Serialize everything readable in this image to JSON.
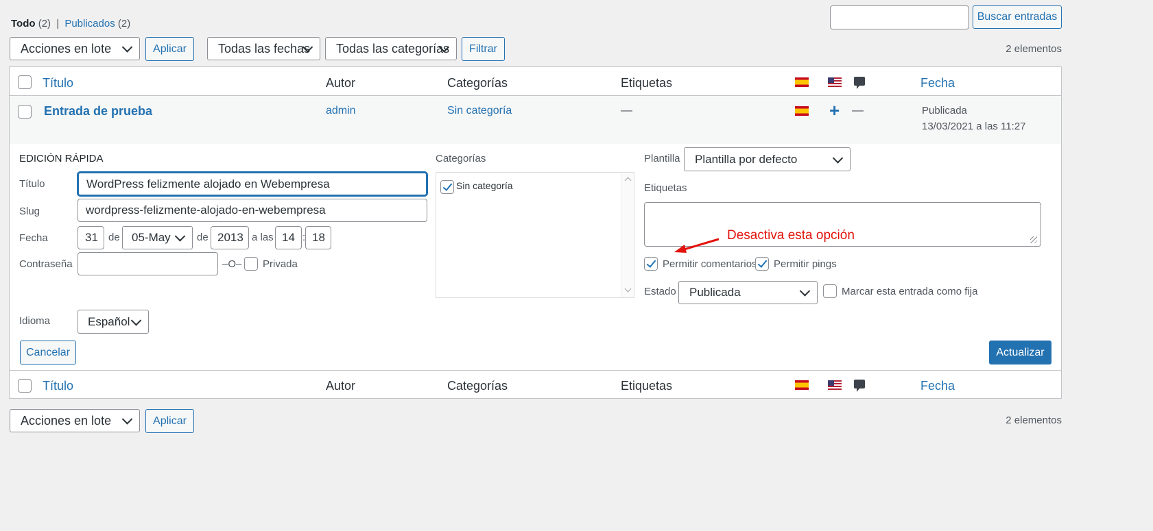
{
  "filters": {
    "all_label": "Todo",
    "all_count": "(2)",
    "separator": "|",
    "published_label": "Publicados",
    "published_count": "(2)"
  },
  "search": {
    "button_label": "Buscar entradas",
    "value": ""
  },
  "toolbar_top": {
    "bulk_select": "Acciones en lote",
    "apply_label": "Aplicar",
    "dates_select": "Todas las fechas",
    "categories_select": "Todas las categorías",
    "filter_label": "Filtrar",
    "item_count": "2 elementos"
  },
  "table": {
    "columns": {
      "title": "Título",
      "author": "Autor",
      "categories": "Categorías",
      "tags": "Etiquetas",
      "date": "Fecha"
    },
    "row": {
      "title": "Entrada de prueba",
      "author": "admin",
      "category": "Sin categoría",
      "tags": "—",
      "translation_add": "+",
      "comments": "—",
      "status": "Publicada",
      "datetime": "13/03/2021 a las 11:27"
    }
  },
  "quick_edit": {
    "heading": "EDICIÓN RÁPIDA",
    "title_label": "Título",
    "title_value": "WordPress felizmente alojado en Webempresa",
    "slug_label": "Slug",
    "slug_value": "wordpress-felizmente-alojado-en-webempresa",
    "date_label": "Fecha",
    "day": "31",
    "de1": "de",
    "month": "05-May",
    "de2": "de",
    "year": "2013",
    "at": "a las",
    "hour": "14",
    "colon": ":",
    "minute": "18",
    "password_label": "Contraseña",
    "password_value": "",
    "or_sep": "–O–",
    "private_label": "Privada",
    "language_label": "Idioma",
    "language_value": "Español",
    "categories_label": "Categorías",
    "category_item": "Sin categoría",
    "template_label": "Plantilla",
    "template_value": "Plantilla por defecto",
    "tags_label": "Etiquetas",
    "tags_value": "",
    "allow_comments_label": "Permitir comentarios",
    "allow_pings_label": "Permitir pings",
    "status_label": "Estado",
    "status_value": "Publicada",
    "sticky_label": "Marcar esta entrada como fija",
    "cancel_label": "Cancelar",
    "update_label": "Actualizar",
    "annotation": "Desactiva esta opción"
  },
  "toolbar_bottom": {
    "bulk_select": "Acciones en lote",
    "apply_label": "Aplicar",
    "item_count": "2 elementos"
  },
  "colors": {
    "accent": "#2271b1",
    "annotation": "#e3120b"
  }
}
